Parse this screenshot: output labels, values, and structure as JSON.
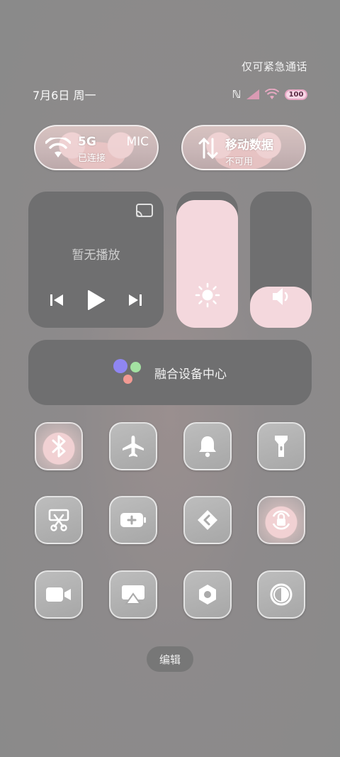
{
  "header": {
    "emergency_text": "仅可紧急通话",
    "date": "7月6日 周一",
    "battery": "100"
  },
  "wifi_pill": {
    "title": "5G",
    "subtitle": "已连接",
    "extra": "MIC"
  },
  "mobile_pill": {
    "title": "移动数据",
    "subtitle": "不可用"
  },
  "media": {
    "status": "暂无播放"
  },
  "sliders": {
    "brightness_level": 0.94,
    "volume_level": 0.3
  },
  "fusion": {
    "label": "融合设备中心"
  },
  "tiles": [
    "bluetooth",
    "airplane-mode",
    "bell",
    "flashlight",
    "screenshot",
    "battery-saver",
    "link",
    "rotation-lock",
    "screen-record",
    "screen-cast",
    "settings",
    "dark-mode"
  ],
  "footer": {
    "edit_label": "编辑"
  }
}
